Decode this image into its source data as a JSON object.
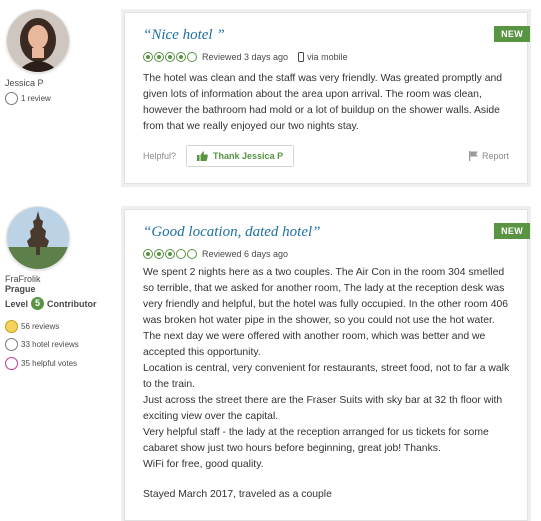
{
  "reviews": [
    {
      "reviewer": {
        "username": "Jessica P",
        "badges": [
          {
            "icon": "reviews-badge-icon",
            "text": "1 review"
          }
        ]
      },
      "title": "“Nice hotel ”",
      "rating_bubbles": 4,
      "rating_max": 5,
      "reviewed": "Reviewed 3 days ago",
      "via_mobile": "via mobile",
      "new_tag": "NEW",
      "body": "The hotel was clean and the staff was very friendly. Was greated promptly and given lots of information about the area upon arrival. The room was clean, however the bathroom had mold or a lot of buildup on the shower walls. Aside from that we really enjoyed our two nights stay.",
      "helpful_label": "Helpful?",
      "thank_label": "Thank Jessica P",
      "report_label": "Report"
    },
    {
      "reviewer": {
        "username": "FraFrolik",
        "location": "Prague",
        "level_label": "Level",
        "level_number": "5",
        "level_title": "Contributor",
        "badges": [
          {
            "icon": "reviews-badge-icon",
            "text": "56 reviews"
          },
          {
            "icon": "hotel-reviews-badge-icon",
            "text": "33 hotel reviews"
          },
          {
            "icon": "helpful-votes-badge-icon",
            "text": "35 helpful votes"
          }
        ]
      },
      "title": "“Good location, dated hotel”",
      "rating_bubbles": 3,
      "rating_max": 5,
      "reviewed": "Reviewed 6 days ago",
      "new_tag": "NEW",
      "body_paragraphs": [
        "We spent 2 nights here as a two couples. The Air Con in the room 304 smelled so terrible, that we asked for another room, The lady at the reception desk was very friendly and helpful, but the hotel was fully occupied. In the other room 406 was broken hot water pipe in the shower, so you could not use the hot water. The next day we were offered with another room, which was better and we accepted this opportunity.",
        "Location is central, very convenient for restaurants, street food, not to far a walk to the train.",
        "Just across the street there are the Fraser Suits with sky bar at 32 th floor with exciting view over the capital.",
        "Very helpful staff - the lady at the reception arranged for us tickets for some cabaret show just two hours before beginning, great job! Thanks.",
        "WiFi for free, good quality."
      ],
      "stayed": "Stayed March 2017, traveled as a couple"
    }
  ],
  "colors": {
    "accent_green": "#589442",
    "title_blue": "#1d6fa6"
  }
}
